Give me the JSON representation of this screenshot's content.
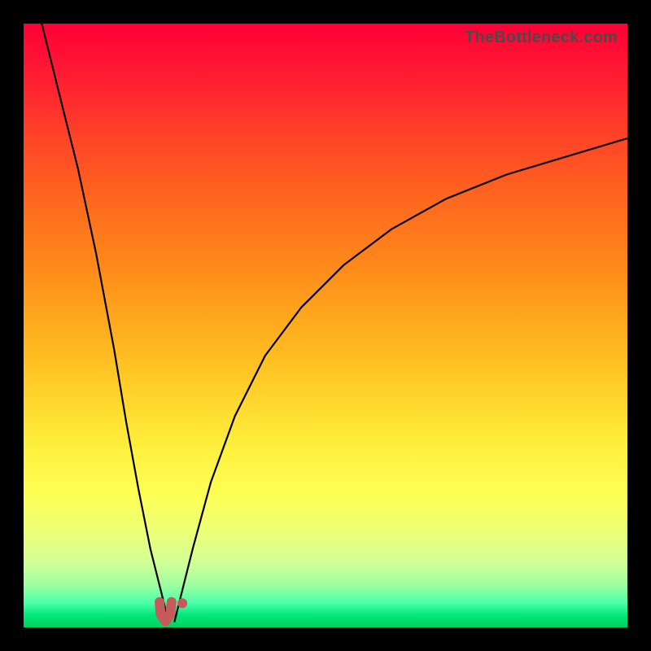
{
  "watermark": "TheBottleneck.com",
  "colors": {
    "frame_bg": "#000000",
    "curve_stroke": "#000000",
    "marker_stroke": "#c55a5a",
    "gradient_top": "#ff0036",
    "gradient_bottom": "#00d060"
  },
  "chart_data": {
    "type": "line",
    "title": "",
    "xlabel": "",
    "ylabel": "",
    "xlim": [
      0,
      100
    ],
    "ylim": [
      0,
      100
    ],
    "grid": false,
    "legend": false,
    "annotations": [
      "TheBottleneck.com"
    ],
    "series": [
      {
        "name": "left-branch",
        "x": [
          3,
          6,
          9,
          12,
          15,
          17,
          19,
          21,
          22.5,
          23.5,
          24
        ],
        "values": [
          100,
          88,
          76,
          62,
          46,
          34,
          23,
          13,
          7,
          3,
          1
        ]
      },
      {
        "name": "right-branch",
        "x": [
          25,
          26,
          28,
          31,
          35,
          40,
          46,
          53,
          61,
          70,
          80,
          90,
          100
        ],
        "values": [
          1,
          5,
          13,
          24,
          35,
          45,
          53,
          60,
          66,
          71,
          75,
          78,
          81
        ]
      },
      {
        "name": "valley-u-marker",
        "x": [
          22.5,
          22.7,
          23.5,
          24.3,
          24.5
        ],
        "values": [
          4.2,
          2.2,
          1.0,
          2.2,
          4.2
        ],
        "style": "thick-rounded",
        "color": "#c55a5a"
      }
    ],
    "points": [
      {
        "name": "valley-dot",
        "x": 26.3,
        "y": 4.0,
        "color": "#c55a5a"
      }
    ]
  }
}
